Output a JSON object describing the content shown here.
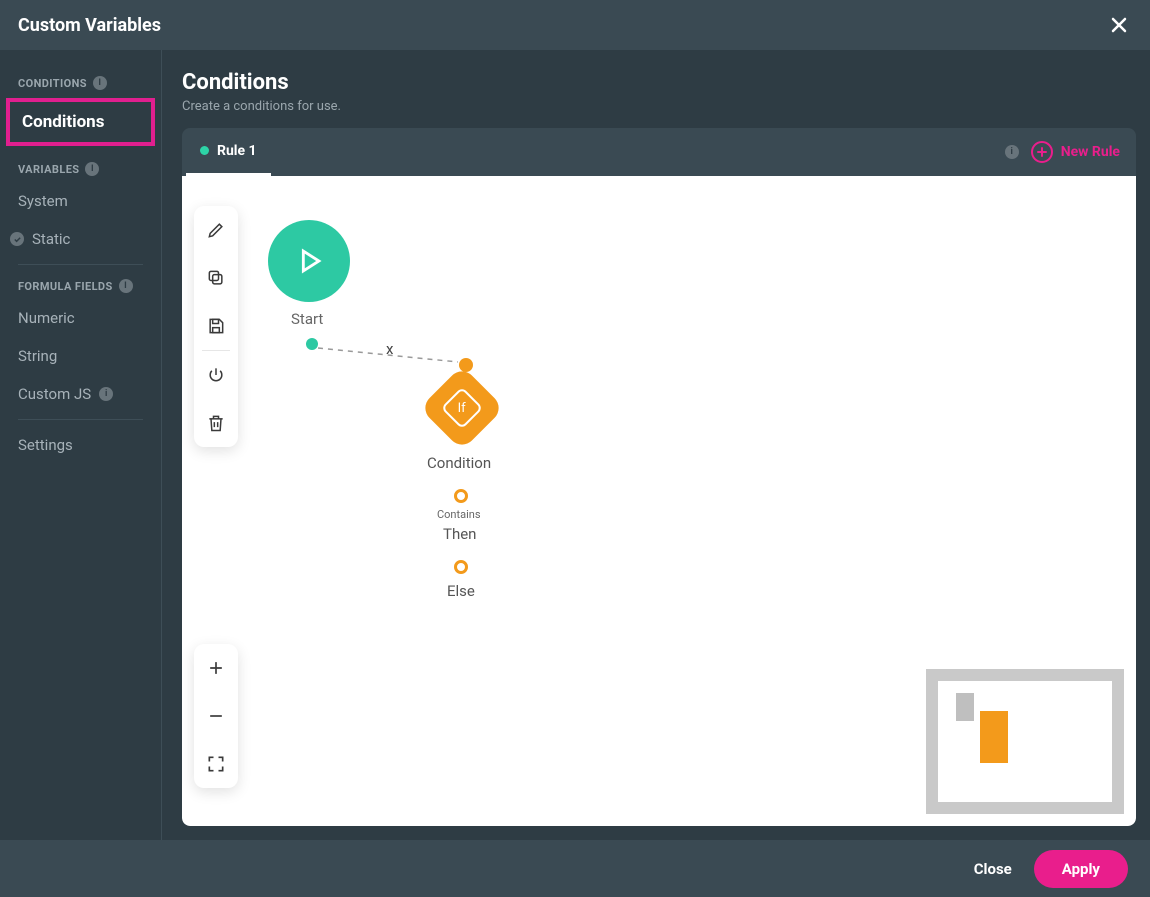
{
  "titlebar": {
    "title": "Custom Variables"
  },
  "sidebar": {
    "sections": [
      {
        "label": "CONDITIONS",
        "items": [
          {
            "label": "Conditions",
            "active": true
          }
        ]
      },
      {
        "label": "VARIABLES",
        "items": [
          {
            "label": "System"
          },
          {
            "label": "Static",
            "checked": true
          }
        ]
      },
      {
        "label": "FORMULA FIELDS",
        "items": [
          {
            "label": "Numeric"
          },
          {
            "label": "String"
          },
          {
            "label": "Custom JS",
            "badge": true
          }
        ]
      }
    ],
    "settings_label": "Settings"
  },
  "main": {
    "title": "Conditions",
    "subtitle": "Create a conditions for use.",
    "tabs": [
      {
        "label": "Rule 1",
        "active": true
      }
    ],
    "new_rule_label": "New Rule"
  },
  "flow": {
    "start_label": "Start",
    "condition_label": "Condition",
    "condition_glyph": "If",
    "contains_label": "Contains",
    "then_label": "Then",
    "else_label": "Else",
    "connector_x": "x"
  },
  "footer": {
    "close": "Close",
    "apply": "Apply"
  }
}
